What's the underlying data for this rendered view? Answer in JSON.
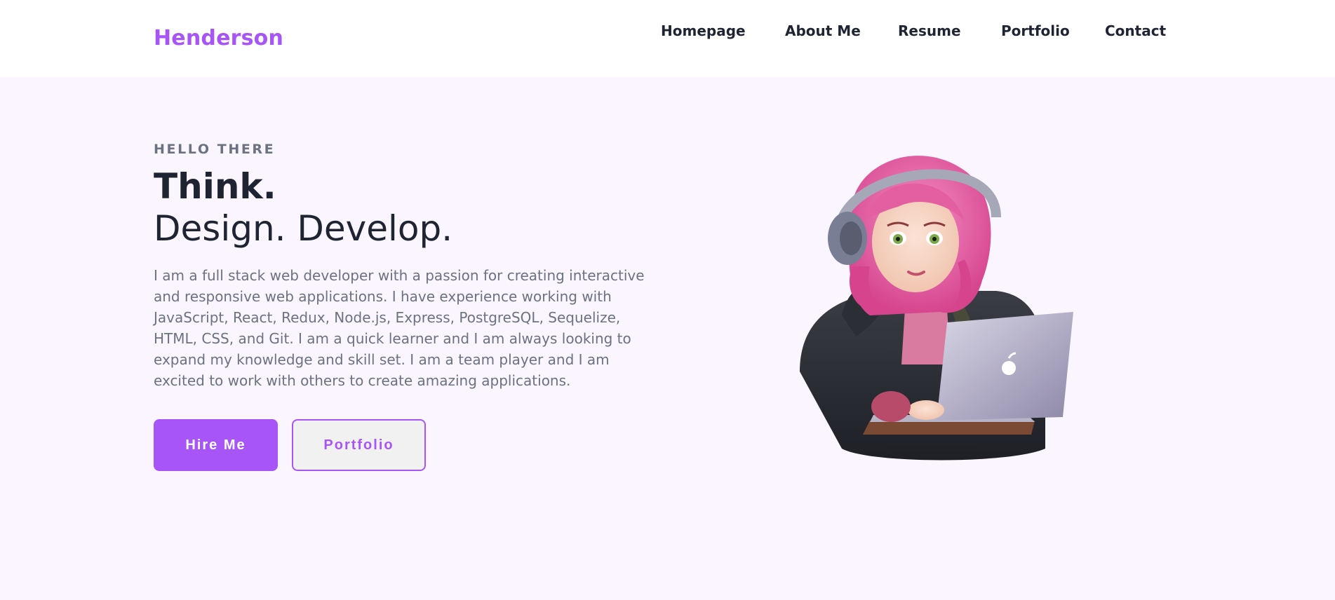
{
  "header": {
    "logo": "Henderson",
    "nav": [
      "Homepage",
      "About Me",
      "Resume",
      "Portfolio",
      "Contact"
    ]
  },
  "hero": {
    "eyebrow": "HELLO THERE",
    "title_line1": "Think.",
    "title_line2": "Design. Develop.",
    "description": "I am a full stack web developer with a passion for creating interactive and responsive web applications. I have experience working with JavaScript, React, Redux, Node.js, Express, PostgreSQL, Sequelize, HTML, CSS, and Git. I am a quick learner and I am always looking to expand my knowledge and skill set. I am a team player and I am excited to work with others to create amazing applications.",
    "primary_button": "Hire Me",
    "secondary_button": "Portfolio"
  },
  "colors": {
    "accent": "#a855f7",
    "heading": "#1f2433",
    "muted": "#6b7280",
    "hero_bg": "#faf5fe"
  },
  "illustration": {
    "icon": "developer-avatar-illustration"
  }
}
